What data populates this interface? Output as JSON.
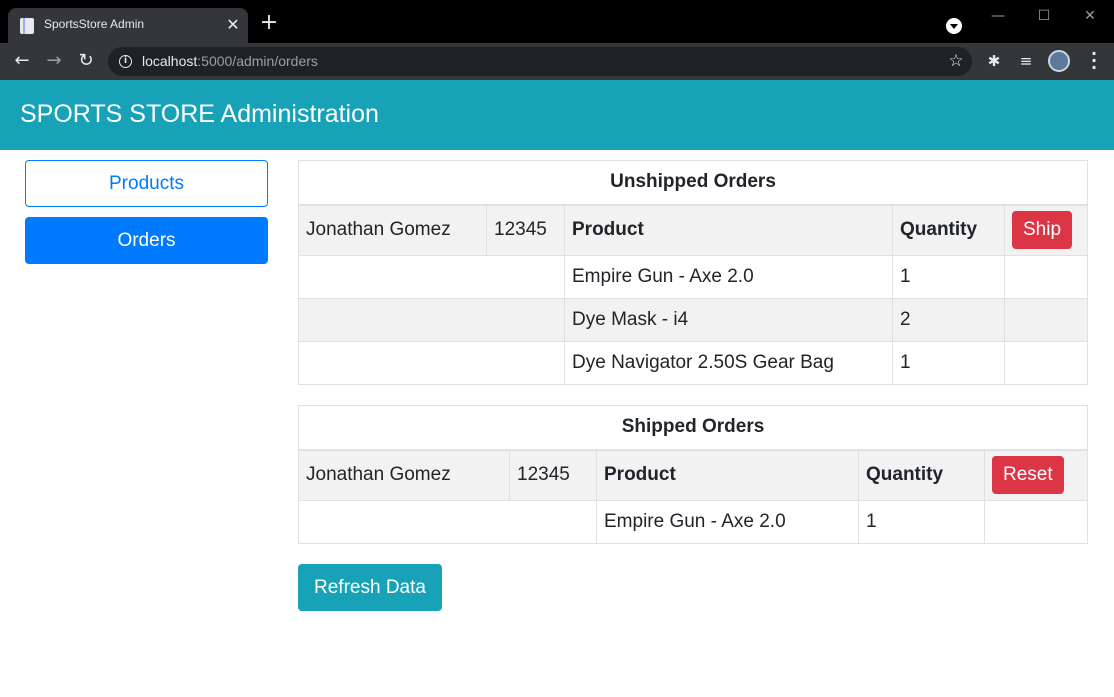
{
  "browser": {
    "tab_title": "SportsStore Admin",
    "url_host": "localhost",
    "url_path": ":5000/admin/orders",
    "icons": [
      "document-icon",
      "close-icon",
      "plus-icon",
      "back-icon",
      "forward-icon",
      "reload-icon",
      "info-icon",
      "star-icon",
      "puzzle-icon",
      "media-icon",
      "avatar",
      "menu-icon"
    ]
  },
  "header": {
    "title": "SPORTS STORE Administration",
    "color": "#17a2b8"
  },
  "sidebar": {
    "products_label": "Products",
    "orders_label": "Orders"
  },
  "unshipped": {
    "title": "Unshipped Orders",
    "customer": "Jonathan Gomez",
    "zip": "12345",
    "product_header": "Product",
    "quantity_header": "Quantity",
    "action_label": "Ship",
    "lines": [
      {
        "product": "Empire Gun - Axe 2.0",
        "quantity": "1"
      },
      {
        "product": "Dye Mask - i4",
        "quantity": "2"
      },
      {
        "product": "Dye Navigator 2.50S Gear Bag",
        "quantity": "1"
      }
    ]
  },
  "shipped": {
    "title": "Shipped Orders",
    "customer": "Jonathan Gomez",
    "zip": "12345",
    "product_header": "Product",
    "quantity_header": "Quantity",
    "action_label": "Reset",
    "lines": [
      {
        "product": "Empire Gun - Axe 2.0",
        "quantity": "1"
      }
    ]
  },
  "refresh_label": "Refresh Data",
  "colors": {
    "primary": "#007bff",
    "danger": "#dc3545",
    "info": "#17a2b8"
  }
}
